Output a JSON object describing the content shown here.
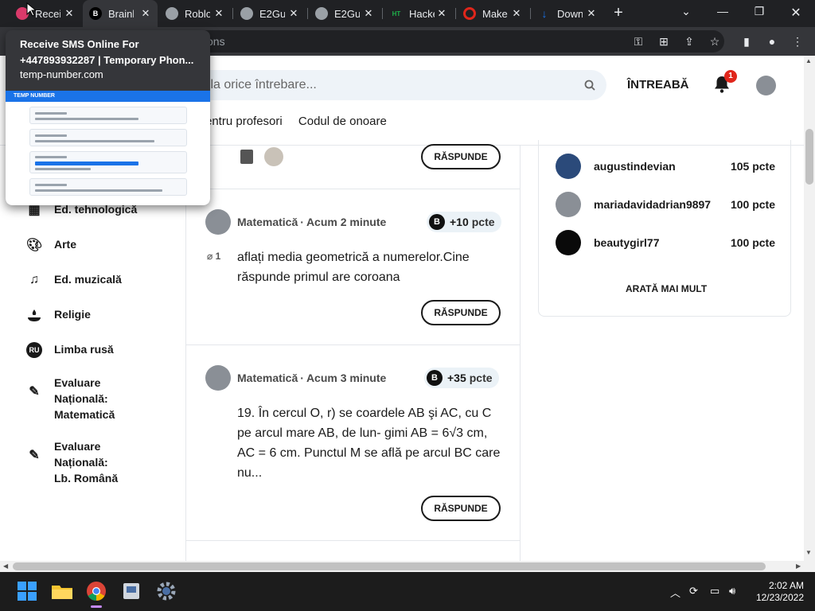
{
  "browser": {
    "tabs": [
      {
        "title": "Receiv",
        "favicon_color": "#d93a6a",
        "favicon_glyph": ""
      },
      {
        "title": "Brainl",
        "favicon_color": "#000000",
        "favicon_glyph": "B"
      },
      {
        "title": "Roblo",
        "favicon_color": "#9aa0a6",
        "favicon_glyph": ""
      },
      {
        "title": "E2Gu",
        "favicon_color": "#9aa0a6",
        "favicon_glyph": ""
      },
      {
        "title": "E2Gu",
        "favicon_color": "#9aa0a6",
        "favicon_glyph": ""
      },
      {
        "title": "Hacke",
        "favicon_color": "#0a7d2c",
        "favicon_glyph": "HT"
      },
      {
        "title": "Make",
        "favicon_color": "#e0261b",
        "favicon_glyph": ""
      },
      {
        "title": "Down",
        "favicon_color": "#1a73e8",
        "favicon_glyph": "↓"
      }
    ],
    "address_fragment": "ons",
    "hovercard": {
      "title": "Receive SMS Online For +447893932287 | Temporary Phon...",
      "url": "temp-number.com",
      "thumb_brand": "TEMP NUMBER"
    }
  },
  "header": {
    "search_placeholder": "s la orice întrebare...",
    "ask_label": "ÎNTREABĂ",
    "notification_count": "1",
    "nav_links": [
      "entru profesori",
      "Codul de onoare"
    ]
  },
  "sidebar": {
    "items": [
      {
        "label": "Ed. tehnologică",
        "icon": "chip-icon"
      },
      {
        "label": "Arte",
        "icon": "palette-icon"
      },
      {
        "label": "Ed. muzicală",
        "icon": "music-note-icon"
      },
      {
        "label": "Religie",
        "icon": "candle-icon"
      },
      {
        "label": "Limba rusă",
        "icon": "ru-badge-icon",
        "glyph": "RU"
      },
      {
        "label": "Evaluare Națională: Matematică",
        "icon": "pencil-icon"
      },
      {
        "label": "Evaluare Națională: Lb. Română",
        "icon": "pencil-icon"
      }
    ]
  },
  "feed": {
    "answer_label": "RĂSPUNDE",
    "points_unit": "pcte",
    "questions": [
      {
        "subject": "Matematică",
        "time": "Acum 2 minute",
        "points": "+10",
        "attachments": "1",
        "text": "aflați media geometrică a numerelor.Cine răspunde primul are coroana"
      },
      {
        "subject": "Matematică",
        "time": "Acum 3 minute",
        "points": "+35",
        "text": "19. În cercul O, r) se coardele AB şi AC, cu C pe arcul mare AB, de lun- gimi AB = 6√3 cm, AC = 6 cm. Punctul M se află pe arcul BC care nu..."
      }
    ]
  },
  "leaderboard": {
    "rows": [
      {
        "name": "augustindevian",
        "points": "105 pcte",
        "avatar_color": "#2b4a7a"
      },
      {
        "name": "mariadavidadrian9897",
        "points": "100 pcte",
        "avatar_color": "#8a8f96"
      },
      {
        "name": "beautygirl77",
        "points": "100 pcte",
        "avatar_color": "#0a0a0a"
      }
    ],
    "more_label": "ARATĂ MAI MULT"
  },
  "taskbar": {
    "time": "2:02 AM",
    "date": "12/23/2022"
  }
}
